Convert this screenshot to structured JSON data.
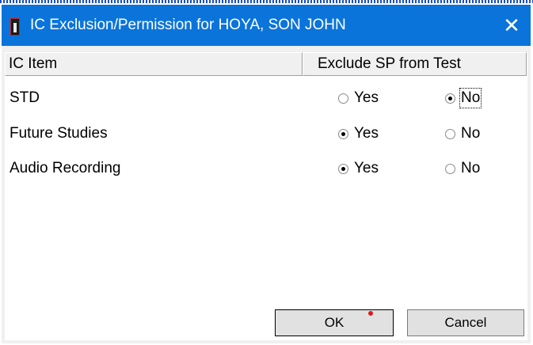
{
  "window": {
    "title": "IC Exclusion/Permission for HOYA, SON JOHN",
    "close_glyph": "✕",
    "accent_color": "#0a74da"
  },
  "table": {
    "columns": [
      "IC Item",
      "Exclude SP from Test"
    ],
    "rows": [
      {
        "item": "STD",
        "yes_label": "Yes",
        "no_label": "No",
        "selected": "No"
      },
      {
        "item": "Future Studies",
        "yes_label": "Yes",
        "no_label": "No",
        "selected": "Yes"
      },
      {
        "item": "Audio Recording",
        "yes_label": "Yes",
        "no_label": "No",
        "selected": "Yes"
      }
    ]
  },
  "buttons": {
    "ok": "OK",
    "cancel": "Cancel"
  },
  "icons": {
    "app": "app-icon",
    "close": "close-icon"
  }
}
